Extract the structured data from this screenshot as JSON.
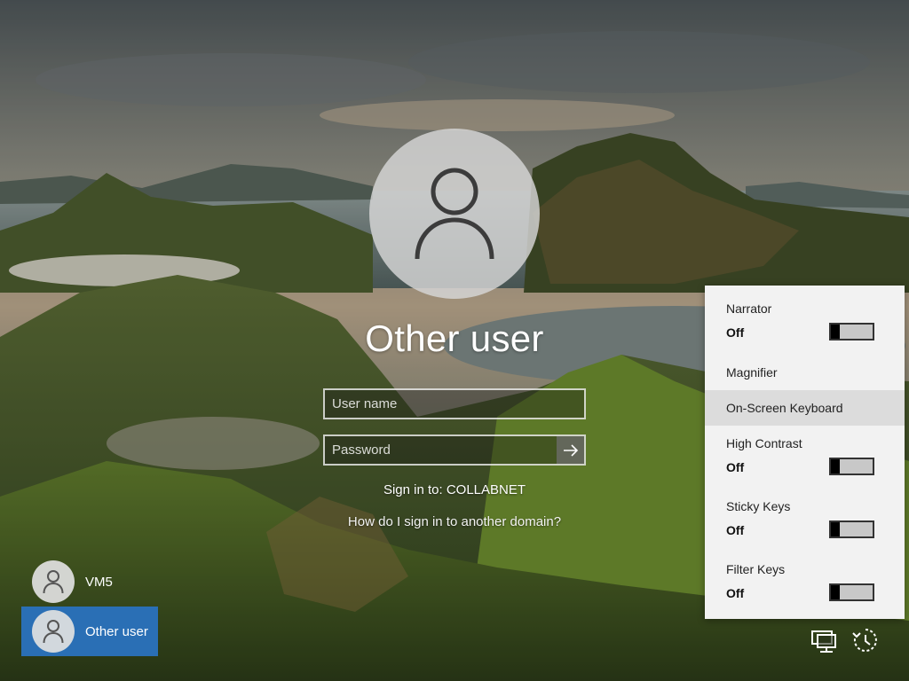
{
  "login": {
    "display_name": "Other user",
    "username_placeholder": "User name",
    "password_placeholder": "Password",
    "sign_in_to": "Sign in to: COLLABNET",
    "other_domain_link": "How do I sign in to another domain?"
  },
  "user_list": [
    {
      "name": "VM5",
      "selected": false
    },
    {
      "name": "Other user",
      "selected": true
    }
  ],
  "ease_of_access": {
    "narrator": {
      "label": "Narrator",
      "state": "Off"
    },
    "magnifier": {
      "label": "Magnifier"
    },
    "on_screen_keyboard": {
      "label": "On-Screen Keyboard"
    },
    "high_contrast": {
      "label": "High Contrast",
      "state": "Off"
    },
    "sticky_keys": {
      "label": "Sticky Keys",
      "state": "Off"
    },
    "filter_keys": {
      "label": "Filter Keys",
      "state": "Off"
    }
  },
  "icons": {
    "avatar": "user-silhouette-icon",
    "submit": "arrow-right-icon",
    "network": "network-icon",
    "ease_of_access": "ease-of-access-icon"
  },
  "colors": {
    "selected_tile": "#2a6fb5",
    "panel_bg": "#f2f2f2",
    "panel_highlight": "#dcdcdc"
  }
}
